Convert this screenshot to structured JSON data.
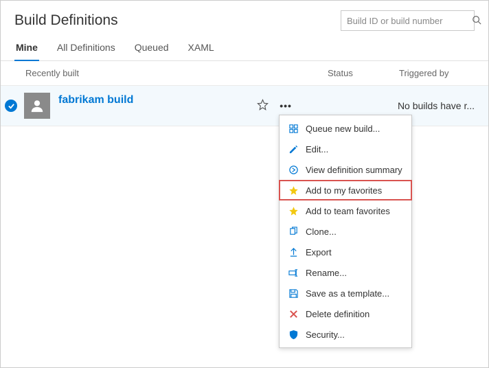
{
  "pageTitle": "Build Definitions",
  "search": {
    "placeholder": "Build ID or build number"
  },
  "tabs": [
    {
      "label": "Mine",
      "active": true
    },
    {
      "label": "All Definitions",
      "active": false
    },
    {
      "label": "Queued",
      "active": false
    },
    {
      "label": "XAML",
      "active": false
    }
  ],
  "columns": {
    "name": "Recently built",
    "status": "Status",
    "triggered": "Triggered by"
  },
  "row": {
    "name": "fabrikam build",
    "triggered": "No builds have r..."
  },
  "menu": {
    "queue": "Queue new build...",
    "edit": "Edit...",
    "view": "View definition summary",
    "addMyFav": "Add to my favorites",
    "addTeamFav": "Add to team favorites",
    "clone": "Clone...",
    "export": "Export",
    "rename": "Rename...",
    "saveTemplate": "Save as a template...",
    "delete": "Delete definition",
    "security": "Security..."
  },
  "colors": {
    "accent": "#0078d4",
    "starYellow": "#f2c811",
    "deleteRed": "#d9534f"
  }
}
